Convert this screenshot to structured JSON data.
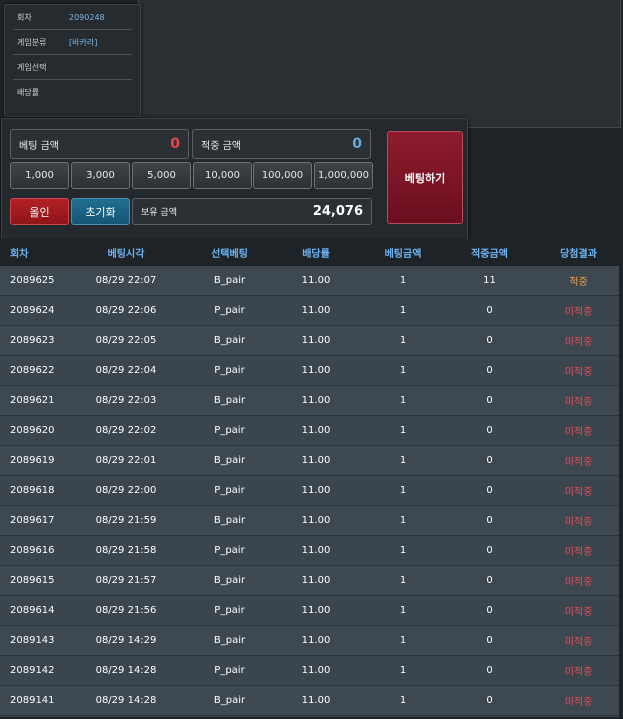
{
  "info": {
    "round_label": "회차",
    "round_value": "2090248",
    "category_label": "게임분류",
    "category_value": "[바카라]",
    "select_label": "게임선택",
    "select_value": "",
    "odds_label": "배당률",
    "odds_value": ""
  },
  "bet": {
    "bet_amount_label": "베팅 금액",
    "bet_amount_value": "0",
    "win_amount_label": "적중 금액",
    "win_amount_value": "0",
    "chips": [
      "1,000",
      "3,000",
      "5,000",
      "10,000",
      "100,000",
      "1,000,000"
    ],
    "allin_label": "올인",
    "reset_label": "초기화",
    "hold_label": "보유 금액",
    "hold_value": "24,076",
    "submit_label": "베팅하기"
  },
  "table": {
    "headers": [
      "회차",
      "베팅시각",
      "선택베팅",
      "배당률",
      "베팅금액",
      "적중금액",
      "당첨결과"
    ],
    "rows": [
      [
        "2089625",
        "08/29 22:07",
        "B_pair",
        "11.00",
        "1",
        "11",
        "적중"
      ],
      [
        "2089624",
        "08/29 22:06",
        "P_pair",
        "11.00",
        "1",
        "0",
        "미적중"
      ],
      [
        "2089623",
        "08/29 22:05",
        "B_pair",
        "11.00",
        "1",
        "0",
        "미적중"
      ],
      [
        "2089622",
        "08/29 22:04",
        "P_pair",
        "11.00",
        "1",
        "0",
        "미적중"
      ],
      [
        "2089621",
        "08/29 22:03",
        "B_pair",
        "11.00",
        "1",
        "0",
        "미적중"
      ],
      [
        "2089620",
        "08/29 22:02",
        "P_pair",
        "11.00",
        "1",
        "0",
        "미적중"
      ],
      [
        "2089619",
        "08/29 22:01",
        "B_pair",
        "11.00",
        "1",
        "0",
        "미적중"
      ],
      [
        "2089618",
        "08/29 22:00",
        "P_pair",
        "11.00",
        "1",
        "0",
        "미적중"
      ],
      [
        "2089617",
        "08/29 21:59",
        "B_pair",
        "11.00",
        "1",
        "0",
        "미적중"
      ],
      [
        "2089616",
        "08/29 21:58",
        "P_pair",
        "11.00",
        "1",
        "0",
        "미적중"
      ],
      [
        "2089615",
        "08/29 21:57",
        "B_pair",
        "11.00",
        "1",
        "0",
        "미적중"
      ],
      [
        "2089614",
        "08/29 21:56",
        "P_pair",
        "11.00",
        "1",
        "0",
        "미적중"
      ],
      [
        "2089143",
        "08/29 14:29",
        "B_pair",
        "11.00",
        "1",
        "0",
        "미적중"
      ],
      [
        "2089142",
        "08/29 14:28",
        "P_pair",
        "11.00",
        "1",
        "0",
        "미적중"
      ],
      [
        "2089141",
        "08/29 14:28",
        "B_pair",
        "11.00",
        "1",
        "0",
        "미적중"
      ]
    ]
  },
  "colors": {
    "win": "#f0a04a",
    "lose": "#ec4a55",
    "header": "#6db3f2"
  }
}
